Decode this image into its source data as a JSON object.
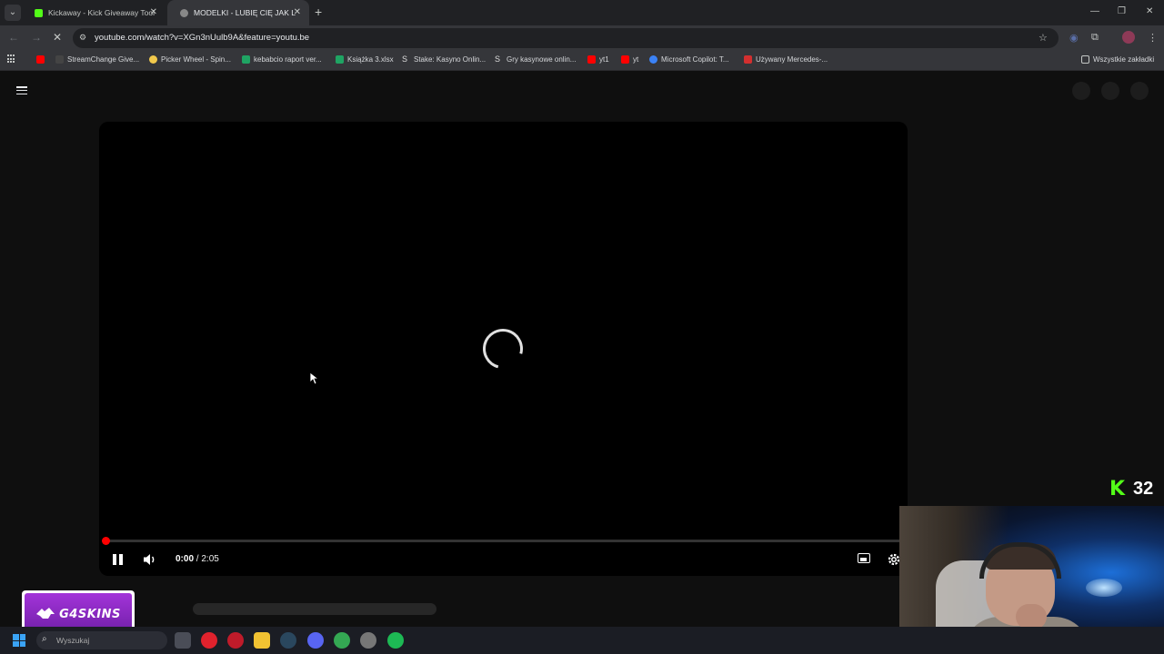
{
  "browser": {
    "tabs": [
      {
        "title": "Kickaway - Kick Giveaway Tool",
        "active": false,
        "favicon_color": "#53fc18"
      },
      {
        "title": "MODELKI - LUBIĘ CIĘ JAK LATO",
        "active": true,
        "favicon_color": "#888888"
      }
    ],
    "address_url": "youtube.com/watch?v=XGn3nUulb9A&feature=youtu.be",
    "bookmarks": [
      {
        "label": "",
        "color": "#ff0000"
      },
      {
        "label": "StreamChange Give...",
        "color": "#444444"
      },
      {
        "label": "Picker Wheel - Spin...",
        "color": "#f2c94c"
      },
      {
        "label": "kebabcio raport ver...",
        "color": "#1fa463"
      },
      {
        "label": "Książka 3.xlsx",
        "color": "#1fa463"
      },
      {
        "label": "Stake: Kasyno Onlin...",
        "color": "#cccccc"
      },
      {
        "label": "Gry kasynowe onlin...",
        "color": "#cccccc"
      },
      {
        "label": "yt1",
        "color": "#ff0000"
      },
      {
        "label": "yt",
        "color": "#ff0000"
      },
      {
        "label": "Microsoft Copilot: T...",
        "color": "#3b82f6"
      },
      {
        "label": "Używany Mercedes-...",
        "color": "#d32f2f"
      }
    ],
    "all_bookmarks_label": "Wszystkie zakładki"
  },
  "player": {
    "current_time": "0:00",
    "separator": " / ",
    "duration": "2:05",
    "progress_fraction": 0.0,
    "state": "loading"
  },
  "overlay": {
    "kick_viewers": "32",
    "kick_color": "#53fc18",
    "sponsor_text": "G4SKINS"
  },
  "taskbar": {
    "search_placeholder": "Wyszukaj",
    "apps": [
      {
        "name": "task-view",
        "color": "#4a4d57"
      },
      {
        "name": "opera",
        "color": "#e0222d"
      },
      {
        "name": "opera-gx",
        "color": "#c01b2a"
      },
      {
        "name": "file-explorer",
        "color": "#f1c232"
      },
      {
        "name": "steam",
        "color": "#2a475e"
      },
      {
        "name": "discord",
        "color": "#5865f2"
      },
      {
        "name": "chrome",
        "color": "#34a853"
      },
      {
        "name": "app-unknown",
        "color": "#777777"
      },
      {
        "name": "spotify",
        "color": "#1db954"
      }
    ]
  }
}
